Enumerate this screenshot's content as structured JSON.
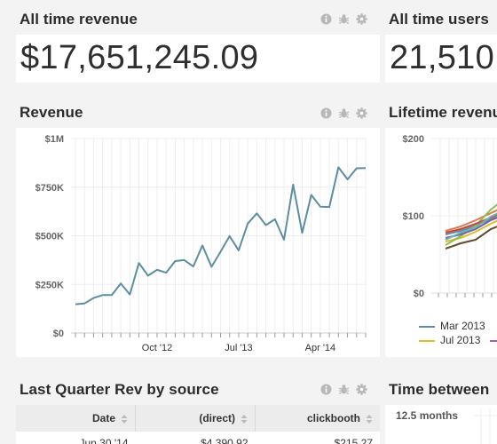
{
  "all_time_revenue": {
    "title": "All time revenue",
    "value": "$17,651,245.09"
  },
  "all_time_users": {
    "title": "All time users",
    "value": "21,510"
  },
  "revenue_panel": {
    "title": "Revenue"
  },
  "lifetime_panel": {
    "title": "Lifetime revenu",
    "y_ticks": [
      "$200",
      "$100",
      "$0"
    ],
    "legend": [
      {
        "label": "Mar 2013",
        "color": "#5b8fb0"
      },
      {
        "label": "Jul 2013",
        "color": "#d8c22a"
      }
    ]
  },
  "last_quarter_panel": {
    "title": "Last Quarter Rev by source",
    "columns": [
      "Date",
      "(direct)",
      "clickbooth"
    ],
    "rows": [
      [
        "Jun 30 '14",
        "$4,390.92",
        "$215.27"
      ]
    ]
  },
  "time_between_panel": {
    "title": "Time between",
    "y_tick": "12.5 months"
  },
  "icons": {
    "info": "info-icon",
    "bug": "bug-icon",
    "gear": "gear-icon"
  },
  "colors": {
    "line": "#5b8ea0",
    "grid": "#eeeeee",
    "axis": "#666666"
  },
  "chart_data": {
    "type": "line",
    "title": "Revenue",
    "xlabel": "",
    "ylabel": "",
    "y_tick_labels": [
      "$1M",
      "$750K",
      "$500K",
      "$250K",
      "$0"
    ],
    "y_ticks": [
      1000000,
      750000,
      500000,
      250000,
      0
    ],
    "ylim": [
      0,
      1000000
    ],
    "x_tick_labels": [
      {
        "label": "Oct '12",
        "index": 9
      },
      {
        "label": "Jul '13",
        "index": 18
      },
      {
        "label": "Apr '14",
        "index": 27
      }
    ],
    "grid": true,
    "series": [
      {
        "values": [
          148000,
          152000,
          180000,
          195000,
          195000,
          255000,
          198000,
          360000,
          295000,
          325000,
          310000,
          370000,
          375000,
          342000,
          450000,
          340000,
          418000,
          498000,
          425000,
          563000,
          615000,
          555000,
          585000,
          480000,
          763000,
          515000,
          710000,
          650000,
          648000,
          852000,
          790000,
          847000,
          848000
        ]
      }
    ]
  }
}
